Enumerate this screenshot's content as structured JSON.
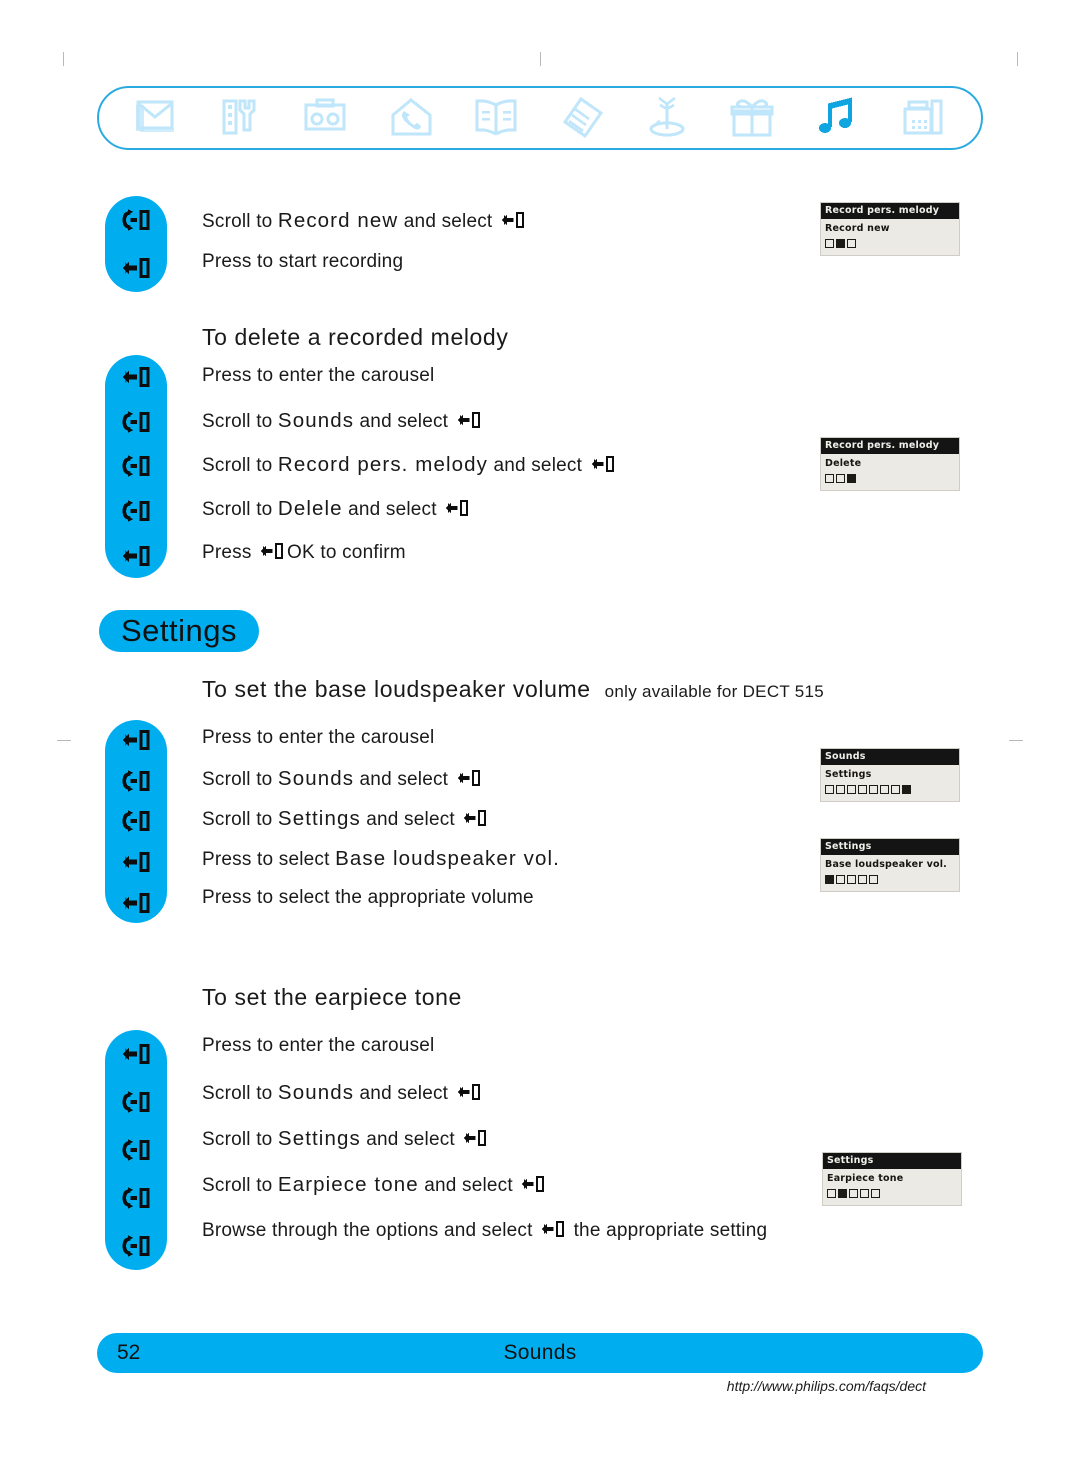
{
  "page": {
    "number": "52",
    "section": "Sounds",
    "url": "http://www.philips.com/faqs/dect"
  },
  "carousel": {
    "icons": [
      {
        "name": "envelope-icon",
        "label": "Messages",
        "active": false
      },
      {
        "name": "tools-icon",
        "label": "Settings",
        "active": false
      },
      {
        "name": "answering-machine-icon",
        "label": "Answering machine",
        "active": false
      },
      {
        "name": "house-phone-icon",
        "label": "Home",
        "active": false
      },
      {
        "name": "open-book-icon",
        "label": "Directory",
        "active": false
      },
      {
        "name": "notes-icon",
        "label": "Notes",
        "active": false
      },
      {
        "name": "base-station-icon",
        "label": "Base station",
        "active": false
      },
      {
        "name": "gift-box-icon",
        "label": "Extras",
        "active": false
      },
      {
        "name": "music-notes-icon",
        "label": "Sounds",
        "active": true
      },
      {
        "name": "fax-icon",
        "label": "Fax",
        "active": false
      }
    ]
  },
  "sections": [
    {
      "id": "record-new",
      "heading": "",
      "keys": [
        "scroll",
        "select"
      ],
      "steps": [
        {
          "parts": [
            {
              "t": "text",
              "v": "Scroll to "
            },
            {
              "t": "mono",
              "v": "Record  new"
            },
            {
              "t": "text",
              "v": " and select "
            },
            {
              "t": "key",
              "v": "select"
            }
          ]
        },
        {
          "parts": [
            {
              "t": "text",
              "v": "Press to start recording"
            }
          ]
        }
      ],
      "screens": [
        {
          "title": "Record pers. melody",
          "line": "Record  new",
          "dots": [
            false,
            true,
            false
          ]
        }
      ]
    },
    {
      "id": "delete-melody",
      "heading": "To delete a recorded melody",
      "heading_note": "",
      "keys": [
        "select",
        "scroll",
        "scroll",
        "scroll",
        "select"
      ],
      "steps": [
        {
          "parts": [
            {
              "t": "text",
              "v": "Press to enter the carousel"
            }
          ]
        },
        {
          "parts": [
            {
              "t": "text",
              "v": "Scroll to "
            },
            {
              "t": "mono",
              "v": "Sounds"
            },
            {
              "t": "text",
              "v": "  and select "
            },
            {
              "t": "key",
              "v": "select"
            }
          ]
        },
        {
          "parts": [
            {
              "t": "text",
              "v": "Scroll to "
            },
            {
              "t": "mono",
              "v": "Record  pers.  melody"
            },
            {
              "t": "text",
              "v": "  and select "
            },
            {
              "t": "key",
              "v": "select"
            }
          ]
        },
        {
          "parts": [
            {
              "t": "text",
              "v": "Scroll to "
            },
            {
              "t": "mono",
              "v": "Delele"
            },
            {
              "t": "text",
              "v": " and select "
            },
            {
              "t": "key",
              "v": "select"
            }
          ]
        },
        {
          "parts": [
            {
              "t": "text",
              "v": "Press "
            },
            {
              "t": "key",
              "v": "select"
            },
            {
              "t": "text",
              "v": "OK to confirm"
            }
          ]
        }
      ],
      "screens": [
        {
          "title": "Record pers. melody",
          "line": "Delete",
          "dots": [
            false,
            false,
            true
          ]
        }
      ]
    },
    {
      "id": "base-loudspeaker-volume",
      "heading": "To set the base loudspeaker volume",
      "heading_note": "only available for DECT 515",
      "keys": [
        "select",
        "scroll",
        "scroll",
        "select",
        "select"
      ],
      "steps": [
        {
          "parts": [
            {
              "t": "text",
              "v": "Press to enter the carousel"
            }
          ]
        },
        {
          "parts": [
            {
              "t": "text",
              "v": "Scroll to "
            },
            {
              "t": "mono",
              "v": "Sounds"
            },
            {
              "t": "text",
              "v": "  and select "
            },
            {
              "t": "key",
              "v": "select"
            }
          ]
        },
        {
          "parts": [
            {
              "t": "text",
              "v": "Scroll to "
            },
            {
              "t": "mono",
              "v": "Settings"
            },
            {
              "t": "text",
              "v": "  and select "
            },
            {
              "t": "key",
              "v": "select"
            }
          ]
        },
        {
          "parts": [
            {
              "t": "text",
              "v": "Press to select "
            },
            {
              "t": "mono",
              "v": "Base  loudspeaker  vol."
            }
          ]
        },
        {
          "parts": [
            {
              "t": "text",
              "v": "Press to select the appropriate volume"
            }
          ]
        }
      ],
      "screens": [
        {
          "title": "Sounds",
          "line": "Settings",
          "dots": [
            false,
            false,
            false,
            false,
            false,
            false,
            false,
            true
          ]
        },
        {
          "title": "Settings",
          "line": "Base loudspeaker vol.",
          "dots": [
            true,
            false,
            false,
            false,
            false
          ]
        }
      ]
    },
    {
      "id": "earpiece-tone",
      "heading": "To set the earpiece tone",
      "heading_note": "",
      "keys": [
        "select",
        "scroll",
        "scroll",
        "scroll",
        "scroll"
      ],
      "steps": [
        {
          "parts": [
            {
              "t": "text",
              "v": "Press to enter the carousel"
            }
          ]
        },
        {
          "parts": [
            {
              "t": "text",
              "v": "Scroll to "
            },
            {
              "t": "mono",
              "v": "Sounds"
            },
            {
              "t": "text",
              "v": "  and select "
            },
            {
              "t": "key",
              "v": "select"
            }
          ]
        },
        {
          "parts": [
            {
              "t": "text",
              "v": "Scroll to "
            },
            {
              "t": "mono",
              "v": "Settings"
            },
            {
              "t": "text",
              "v": "  and select "
            },
            {
              "t": "key",
              "v": "select"
            }
          ]
        },
        {
          "parts": [
            {
              "t": "text",
              "v": "Scroll to "
            },
            {
              "t": "mono",
              "v": "Earpiece  tone"
            },
            {
              "t": "text",
              "v": " and select "
            },
            {
              "t": "key",
              "v": "select"
            }
          ]
        },
        {
          "parts": [
            {
              "t": "text",
              "v": "Browse through the options and select "
            },
            {
              "t": "key",
              "v": "select"
            },
            {
              "t": "text",
              "v": " the appropriate setting"
            }
          ]
        }
      ],
      "screens": [
        {
          "title": "Settings",
          "line": "Earpiece tone",
          "dots": [
            false,
            true,
            false,
            false,
            false
          ]
        }
      ]
    }
  ],
  "settings_badge": {
    "label": "Settings"
  },
  "colors": {
    "brand_blue": "#00AEEF",
    "carousel_border": "#29ABE2",
    "icon_pale": "#BFE6FA",
    "lcd_bg": "#ECEAE4",
    "lcd_header": "#141414"
  }
}
